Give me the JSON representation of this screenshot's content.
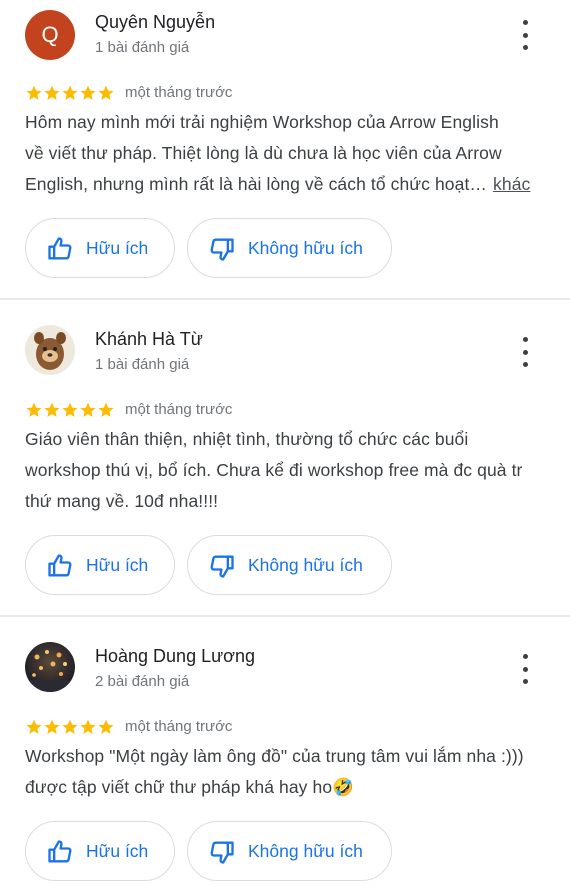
{
  "reviews": [
    {
      "avatar_letter": "Q",
      "name": "Quyên Nguyễn",
      "review_count": "1 bài đánh giá",
      "rating": 5,
      "time": "một tháng trước",
      "text_lines": [
        "Hôm nay mình mới trải nghiệm Workshop của Arrow English",
        "về viết thư pháp. Thiệt lòng là dù chưa là học viên của Arrow",
        "English, nhưng mình rất là hài lòng về cách tổ chức hoạt…"
      ],
      "more_label": "khác",
      "helpful_label": "Hữu ích",
      "unhelpful_label": "Không hữu ích"
    },
    {
      "name": "Khánh Hà Từ",
      "review_count": "1 bài đánh giá",
      "rating": 5,
      "time": "một tháng trước",
      "text_lines": [
        "Giáo viên thân thiện, nhiệt tình, thường tổ chức các buổi",
        "workshop thú vị, bổ ích. Chưa kể đi workshop free mà đc quà tr",
        "thứ mang về. 10đ nha!!!!"
      ],
      "helpful_label": "Hữu ích",
      "unhelpful_label": "Không hữu ích"
    },
    {
      "name": "Hoàng Dung Lương",
      "review_count": "2 bài đánh giá",
      "rating": 5,
      "time": "một tháng trước",
      "text_lines": [
        "Workshop \"Một ngày làm ông đồ\" của trung tâm vui lắm nha :)))",
        "được tập viết chữ thư pháp khá hay ho🤣"
      ],
      "helpful_label": "Hữu ích",
      "unhelpful_label": "Không hữu ích"
    }
  ],
  "icons": {
    "star": "star-icon",
    "more": "more-vert-icon",
    "thumb_up": "thumb-up-icon",
    "thumb_down": "thumb-down-icon"
  },
  "colors": {
    "star": "#fbbc04",
    "button_text": "#1a73e8",
    "avatar_q": "#c3431f"
  }
}
